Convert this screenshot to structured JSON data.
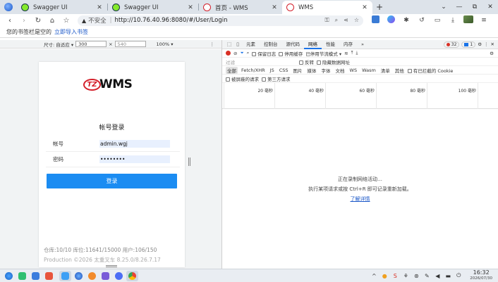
{
  "tabs": [
    {
      "title": "Swagger UI",
      "icon": "swagger-icon",
      "active": false
    },
    {
      "title": "Swagger UI",
      "icon": "swagger-icon",
      "active": false
    },
    {
      "title": "首页 - WMS",
      "icon": "tzwms-icon",
      "active": false
    },
    {
      "title": "WMS",
      "icon": "tzwms-icon",
      "active": true
    }
  ],
  "toolbar": {
    "security_label": "不安全",
    "url": "http://10.76.40.96:8080/#/User/Login"
  },
  "bookmarks": {
    "empty_text": "您的书签栏是空的",
    "import_link": "立即导入书签"
  },
  "device": {
    "size_label": "尺寸: 自适应 ▾",
    "width": "300",
    "times": "×",
    "height": "540",
    "zoom": "100% ▾"
  },
  "login": {
    "logo_mark": "TZ",
    "logo_text": "WMS",
    "title": "帐号登录",
    "account_label": "帐号",
    "account_value": "admin.wgj",
    "password_label": "密码",
    "password_value": "••••••••",
    "button": "登录",
    "stats": "仓库:10/10  库位:11641/15000  用户:106/150",
    "copyright": "Production ©2026 太重叉车 8.25.0/8.26.7.17"
  },
  "devtools": {
    "tabs": [
      "元素",
      "控制台",
      "源代码",
      "网络",
      "性能",
      "内存",
      "»"
    ],
    "active_tab": "网络",
    "error_count": "32",
    "info_count": "1",
    "controls": {
      "preserve_log": "保留日志",
      "disable_cache": "停用缓存",
      "throttle": "已停用节流模式 ▾"
    },
    "filter": {
      "placeholder": "过滤",
      "invert": "反转",
      "hide_data_urls": "隐藏数据网址"
    },
    "types": [
      "全部",
      "Fetch/XHR",
      "JS",
      "CSS",
      "图片",
      "媒体",
      "字体",
      "文档",
      "WS",
      "Wasm",
      "清单",
      "其他"
    ],
    "blocked_cookies": "有已拦截的 Cookie",
    "blocked_requests": "被屏蔽的请求",
    "third_party": "第三方请求",
    "timeline_ticks": [
      "20 毫秒",
      "40 毫秒",
      "60 毫秒",
      "80 毫秒",
      "100 毫秒"
    ],
    "empty_recording": "正在录制网络活动…",
    "empty_hint": "执行某项请求或按 Ctrl+R 即可记录重新加载。",
    "learn_more": "了解详情"
  },
  "taskbar": {
    "time": "16:32",
    "date": "2026/07/30"
  }
}
